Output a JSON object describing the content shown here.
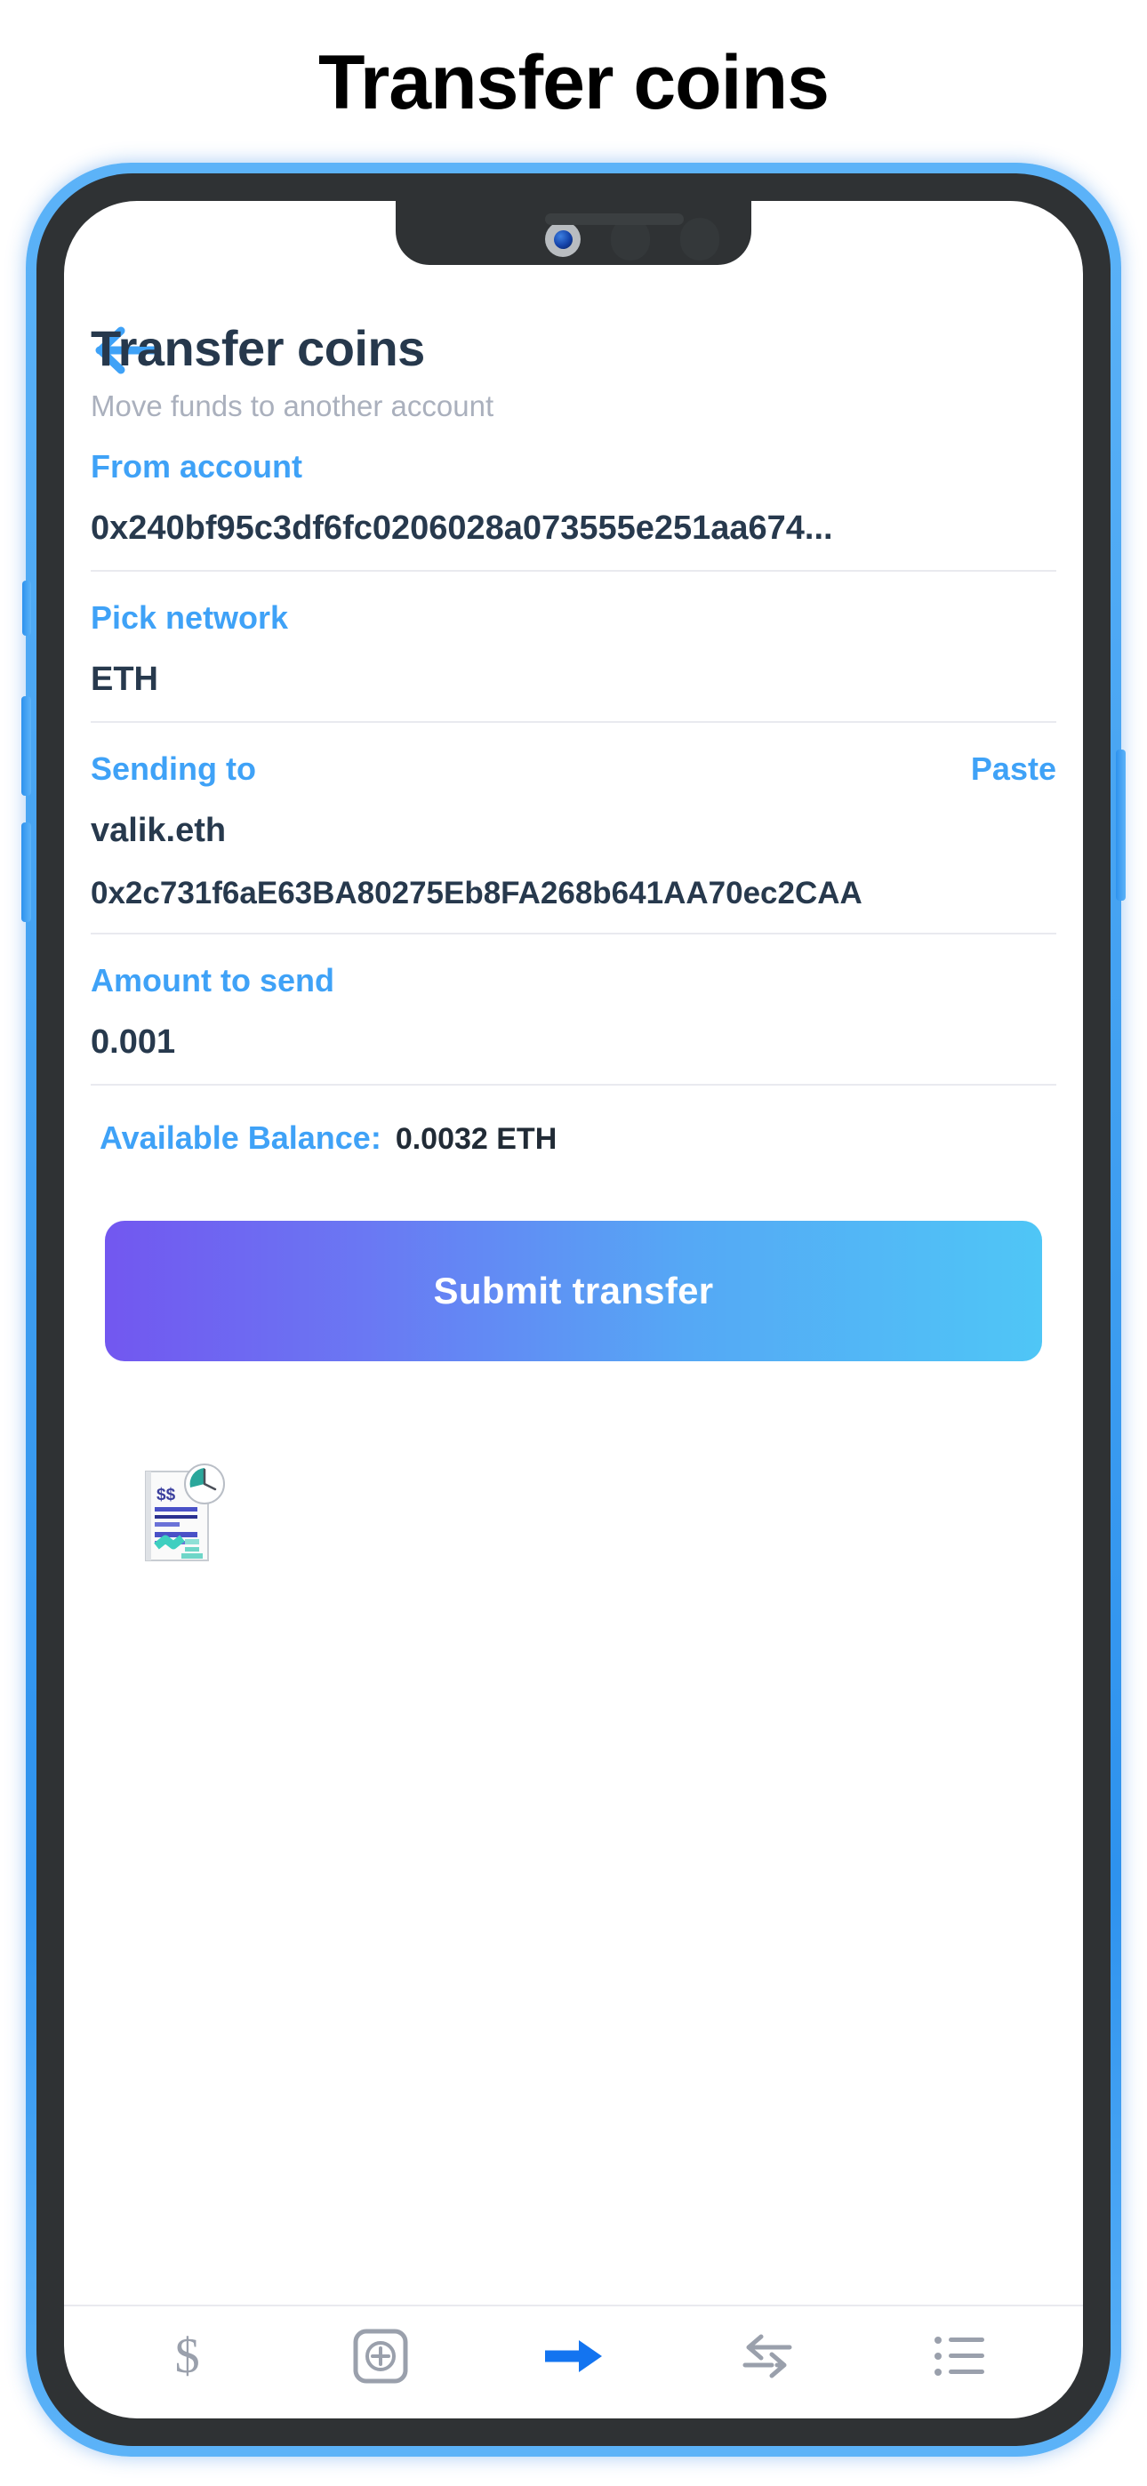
{
  "page": {
    "title": "Transfer coins"
  },
  "device": {
    "bezel_color": "#47a4f2",
    "frame_color": "#2f3234",
    "screen_color": "#ffffff"
  },
  "app": {
    "back_button": "back-arrow",
    "heading": "Transfer coins",
    "subheading": "Move funds to another account",
    "fields": {
      "from_account": {
        "label": "From account",
        "value": "0x240bf95c3df6fc0206028a073555e251aa674..."
      },
      "network": {
        "label": "Pick network",
        "value": "ETH"
      },
      "sending_to": {
        "label": "Sending to",
        "action": "Paste",
        "name_value": "valik.eth",
        "address_value": "0x2c731f6aE63BA80275Eb8FA268b641AA70ec2CAA"
      },
      "amount": {
        "label": "Amount to send",
        "value": "0.001"
      }
    },
    "balance": {
      "label": "Available Balance:",
      "value": "0.0032 ETH"
    },
    "submit_button": "Submit transfer",
    "colors": {
      "accent_blue": "#3fa2f7",
      "heading_navy": "#26384c",
      "subtitle_gray": "#aab0bd",
      "rule_gray": "#e9eaef",
      "button_gradient_start": "#7257f0",
      "button_gradient_end": "#4fc6f6",
      "nav_icon_gray": "#9aa0ac",
      "nav_active_blue": "#1374f0"
    },
    "illustration": "invoice-clock-illustration",
    "bottom_nav": [
      {
        "icon": "dollar-icon",
        "active": false
      },
      {
        "icon": "add-circle-icon",
        "active": false
      },
      {
        "icon": "arrow-right-icon",
        "active": true
      },
      {
        "icon": "exchange-arrows-icon",
        "active": false
      },
      {
        "icon": "list-icon",
        "active": false
      }
    ]
  }
}
